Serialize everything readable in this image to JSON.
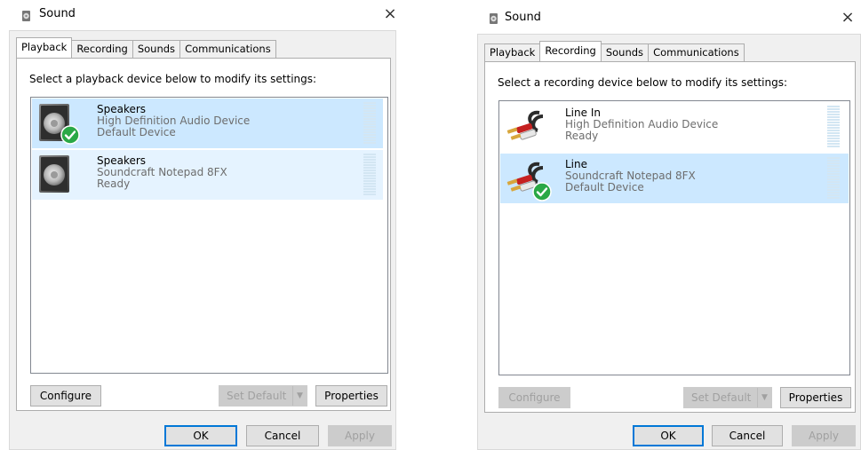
{
  "playback_dialog": {
    "title": "Sound",
    "close_label": "×",
    "tabs": [
      {
        "label": "Playback",
        "active": true
      },
      {
        "label": "Recording",
        "active": false
      },
      {
        "label": "Sounds",
        "active": false
      },
      {
        "label": "Communications",
        "active": false
      }
    ],
    "instruction": "Select a playback device below to modify its settings:",
    "devices": [
      {
        "name": "Speakers",
        "line2": "High Definition Audio Device",
        "line3": "Default Device",
        "selected": true,
        "default": true,
        "icon": "speaker-icon"
      },
      {
        "name": "Speakers",
        "line2": "Soundcraft Notepad 8FX",
        "line3": "Ready",
        "selected": false,
        "default": false,
        "icon": "speaker-icon"
      }
    ],
    "buttons": {
      "configure": "Configure",
      "set_default": "Set Default",
      "properties": "Properties",
      "ok": "OK",
      "cancel": "Cancel",
      "apply": "Apply"
    }
  },
  "recording_dialog": {
    "title": "Sound",
    "close_label": "×",
    "tabs": [
      {
        "label": "Playback",
        "active": false
      },
      {
        "label": "Recording",
        "active": true
      },
      {
        "label": "Sounds",
        "active": false
      },
      {
        "label": "Communications",
        "active": false
      }
    ],
    "instruction": "Select a recording device below to modify its settings:",
    "devices": [
      {
        "name": "Line In",
        "line2": "High Definition Audio Device",
        "line3": "Ready",
        "selected": false,
        "default": false,
        "icon": "rca-cable-icon"
      },
      {
        "name": "Line",
        "line2": "Soundcraft Notepad 8FX",
        "line3": "Default Device",
        "selected": true,
        "default": true,
        "icon": "rca-cable-icon"
      }
    ],
    "buttons": {
      "configure": "Configure",
      "set_default": "Set Default",
      "properties": "Properties",
      "ok": "OK",
      "cancel": "Cancel",
      "apply": "Apply"
    }
  },
  "colors": {
    "selected_row": "#cce8ff",
    "hover_row": "#e5f3ff",
    "check_green": "#2aa846",
    "focus_blue": "#0078d7"
  }
}
